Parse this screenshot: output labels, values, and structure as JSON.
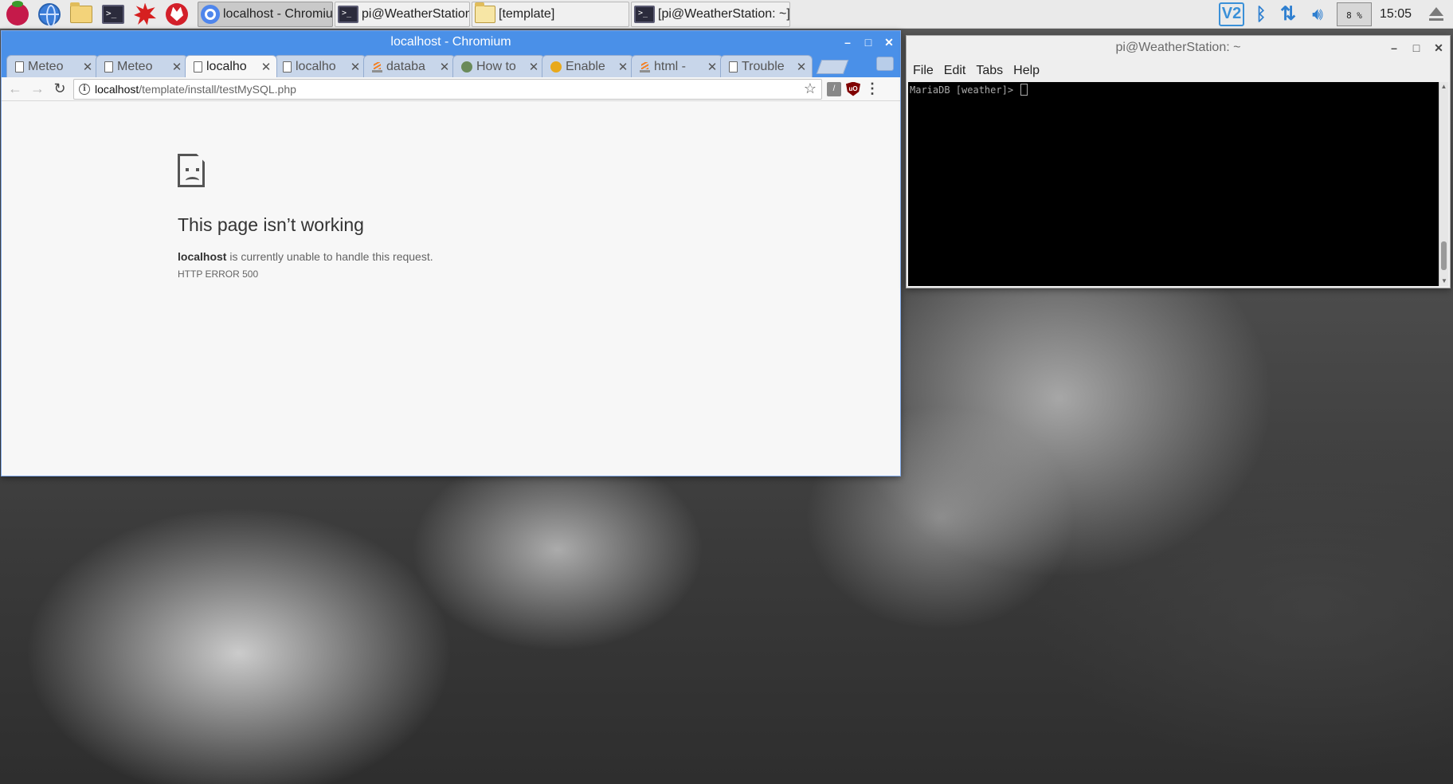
{
  "taskbar": {
    "launchers": [
      {
        "name": "raspberry-menu-icon"
      },
      {
        "name": "web-browser-icon"
      },
      {
        "name": "file-manager-icon"
      },
      {
        "name": "terminal-icon"
      },
      {
        "name": "mathematica-icon"
      },
      {
        "name": "wolfram-icon"
      }
    ],
    "tasks": [
      {
        "label": "localhost - Chromium",
        "icon": "chromium-icon",
        "active": true
      },
      {
        "label": "pi@WeatherStation: ~",
        "icon": "terminal-icon",
        "active": false
      },
      {
        "label": "[template]",
        "icon": "folder-icon",
        "active": false
      },
      {
        "label": "[pi@WeatherStation: ~]",
        "icon": "terminal-icon",
        "active": false
      }
    ],
    "tray": {
      "vnc_label": "V2",
      "cpu_usage": "8 %",
      "clock": "15:05"
    }
  },
  "chromium": {
    "title": "localhost - Chromium",
    "tabs": [
      {
        "label": "Meteo",
        "icon": "page-icon",
        "active": false
      },
      {
        "label": "Meteo",
        "icon": "page-icon",
        "active": false
      },
      {
        "label": "localho",
        "icon": "page-icon",
        "active": true
      },
      {
        "label": "localho",
        "icon": "page-icon",
        "active": false
      },
      {
        "label": "databa",
        "icon": "stackoverflow-icon",
        "active": false
      },
      {
        "label": "How to",
        "icon": "github-icon",
        "active": false
      },
      {
        "label": "Enable",
        "icon": "askubuntu-icon",
        "active": false
      },
      {
        "label": "html - ",
        "icon": "stackoverflow-icon",
        "active": false
      },
      {
        "label": "Trouble",
        "icon": "page-icon",
        "active": false
      }
    ],
    "address": {
      "host": "localhost",
      "path": "/template/install/testMySQL.php"
    },
    "error": {
      "title": "This page isn’t working",
      "host": "localhost",
      "message": " is currently unable to handle this request.",
      "code": "HTTP ERROR 500"
    }
  },
  "terminal": {
    "title": "pi@WeatherStation: ~",
    "menu": [
      "File",
      "Edit",
      "Tabs",
      "Help"
    ],
    "prompt": "MariaDB [weather]> "
  }
}
